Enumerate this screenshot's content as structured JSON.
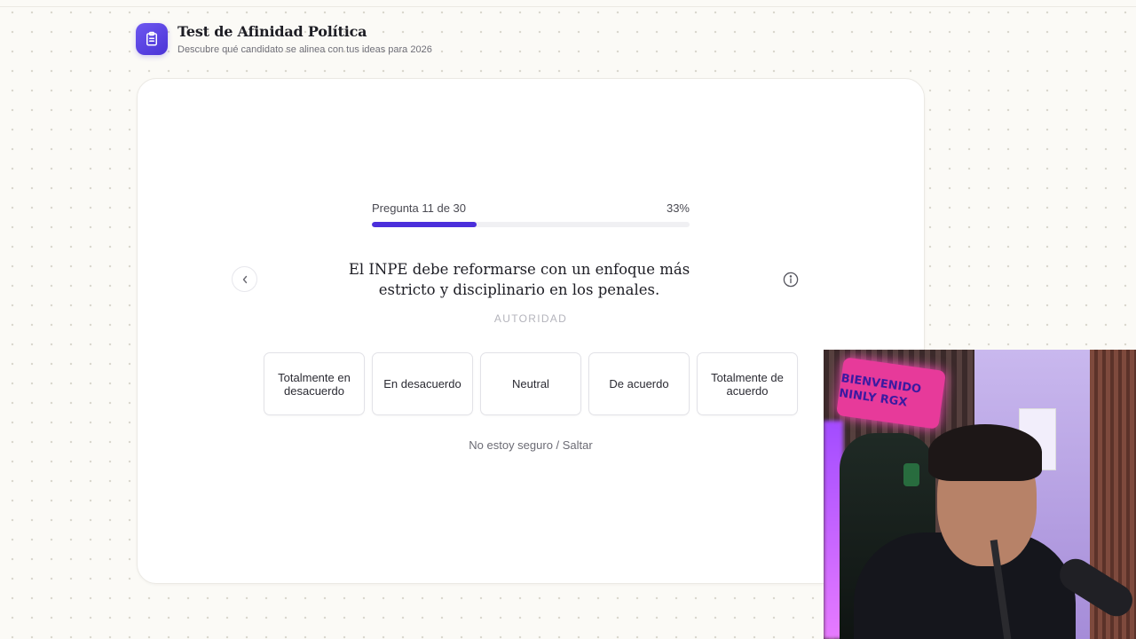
{
  "app": {
    "title": "Test de Afinidad Política",
    "subtitle": "Descubre qué candidato se alinea con tus ideas para 2026",
    "logo_icon": "clipboard-icon",
    "accent": "#4b2fdb"
  },
  "progress": {
    "label": "Pregunta 11 de 30",
    "percent_label": "33%",
    "fraction": 0.33
  },
  "question": {
    "text": "El INPE debe reformarse con un enfoque más estricto y disciplinario en los penales.",
    "category": "AUTORIDAD"
  },
  "navigation": {
    "prev_icon": "chevron-left-icon",
    "info_icon": "info-icon"
  },
  "options": [
    {
      "label": "Totalmente en desacuerdo"
    },
    {
      "label": "En desacuerdo"
    },
    {
      "label": "Neutral"
    },
    {
      "label": "De acuerdo"
    },
    {
      "label": "Totalmente de acuerdo"
    }
  ],
  "skip_label": "No estoy seguro / Saltar",
  "webcam": {
    "neon_sign_text": "BIENVENIDO NINLY RGX"
  }
}
